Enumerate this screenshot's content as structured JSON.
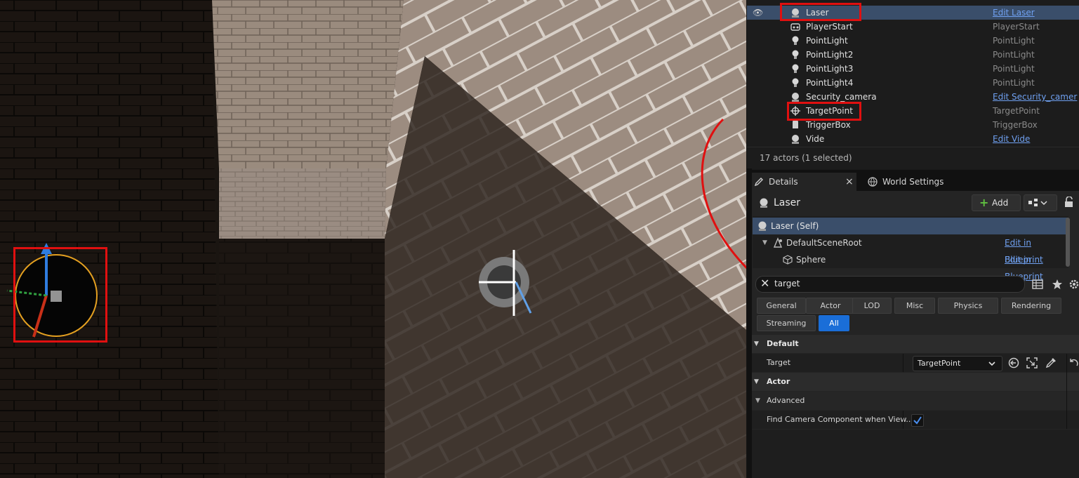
{
  "outliner": {
    "rows": [
      {
        "name": "Laser",
        "type": "Edit Laser",
        "type_link": true,
        "selected": true,
        "icon": "actor-sphere-icon"
      },
      {
        "name": "PlayerStart",
        "type": "PlayerStart",
        "type_link": false,
        "selected": false,
        "icon": "player-start-icon"
      },
      {
        "name": "PointLight",
        "type": "PointLight",
        "type_link": false,
        "selected": false,
        "icon": "point-light-icon"
      },
      {
        "name": "PointLight2",
        "type": "PointLight",
        "type_link": false,
        "selected": false,
        "icon": "point-light-icon"
      },
      {
        "name": "PointLight3",
        "type": "PointLight",
        "type_link": false,
        "selected": false,
        "icon": "point-light-icon"
      },
      {
        "name": "PointLight4",
        "type": "PointLight",
        "type_link": false,
        "selected": false,
        "icon": "point-light-icon"
      },
      {
        "name": "Security_camera",
        "type": "Edit Security_camer",
        "type_link": true,
        "selected": false,
        "icon": "actor-sphere-icon"
      },
      {
        "name": "TargetPoint",
        "type": "TargetPoint",
        "type_link": false,
        "selected": false,
        "icon": "target-point-icon"
      },
      {
        "name": "TriggerBox",
        "type": "TriggerBox",
        "type_link": false,
        "selected": false,
        "icon": "trigger-box-icon"
      },
      {
        "name": "Vide",
        "type": "Edit Vide",
        "type_link": true,
        "selected": false,
        "icon": "actor-sphere-icon"
      }
    ],
    "footer": "17 actors (1 selected)"
  },
  "tabs": {
    "details": "Details",
    "close": "×",
    "world_settings": "World Settings"
  },
  "details": {
    "title": "Laser",
    "add_label": "Add",
    "components": {
      "self": "Laser (Self)",
      "root": "DefaultSceneRoot",
      "root_link": "Edit in Blueprint",
      "sphere": "Sphere",
      "sphere_link": "Edit in Blueprint"
    },
    "search_value": "target",
    "filters": [
      "General",
      "Actor",
      "LOD",
      "Misc",
      "Physics",
      "Rendering",
      "Streaming",
      "All"
    ],
    "active_filter": "All",
    "sections": {
      "default": "Default",
      "target_label": "Target",
      "target_value": "TargetPoint",
      "actor": "Actor",
      "advanced": "Advanced",
      "find_camera_label": "Find Camera Component when View...",
      "find_camera_checked": true
    }
  },
  "colors": {
    "selection": "#3a4e6a",
    "link": "#6fa0f0",
    "accent": "#1a6ed8",
    "annotation": "#e01010"
  }
}
